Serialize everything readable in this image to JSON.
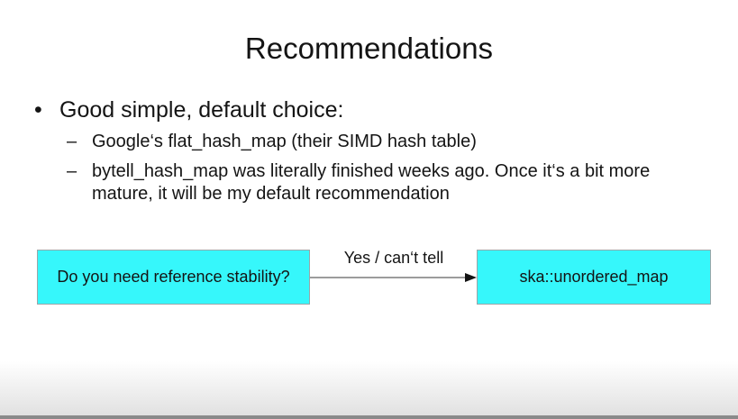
{
  "slide": {
    "title": "Recommendations",
    "bullet": {
      "marker": "•",
      "text": "Good simple, default choice:"
    },
    "sub_items": [
      {
        "marker": "–",
        "text": "Google‘s flat_hash_map (their SIMD hash table)"
      },
      {
        "marker": "–",
        "text": "bytell_hash_map was literally finished weeks ago. Once it‘s a bit more mature, it will be my default recommendation"
      }
    ]
  },
  "flowchart": {
    "question_box": "Do you need reference stability?",
    "edge_label": "Yes / can‘t tell",
    "answer_box": "ska::unordered_map",
    "box_color": "#36f7fb"
  }
}
